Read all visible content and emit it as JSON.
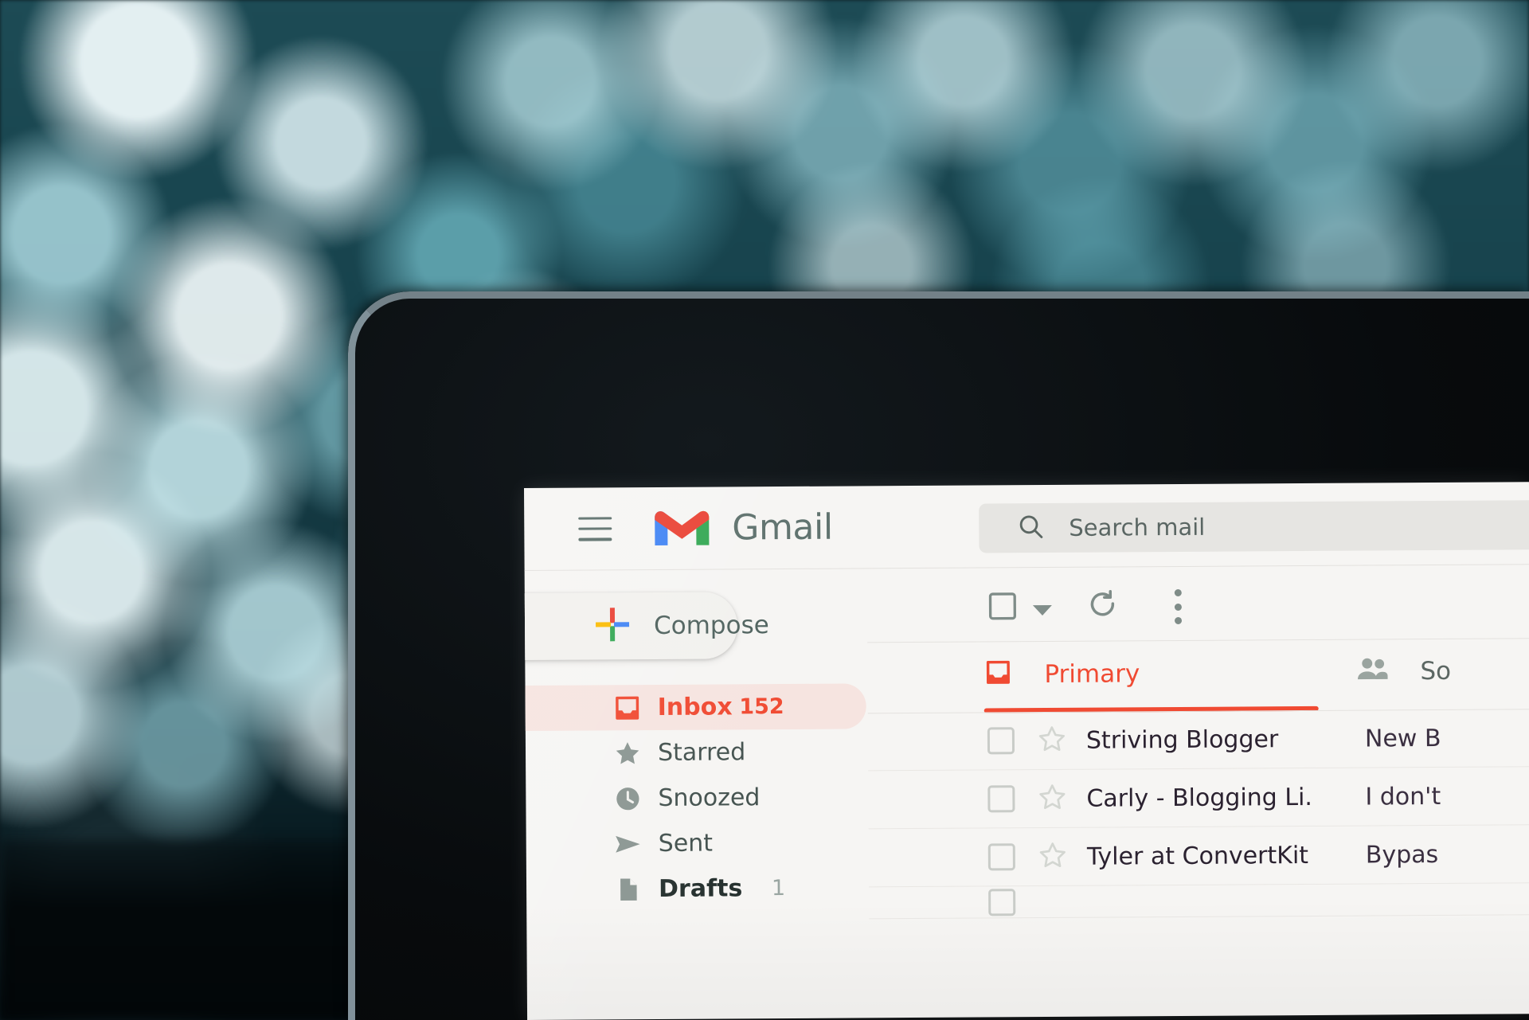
{
  "app": {
    "name": "Gmail",
    "brand_red": "#f04a32",
    "menu_icon": "hamburger-menu-icon",
    "logo_icon": "gmail-m-logo"
  },
  "search": {
    "icon": "search-icon",
    "placeholder": "Search mail",
    "value": ""
  },
  "sidebar": {
    "compose": {
      "label": "Compose",
      "icon": "plus-icon"
    },
    "items": [
      {
        "label": "Inbox",
        "count": "152",
        "icon": "inbox-icon",
        "active": true
      },
      {
        "label": "Starred",
        "count": "",
        "icon": "star-icon",
        "active": false
      },
      {
        "label": "Snoozed",
        "count": "",
        "icon": "clock-icon",
        "active": false
      },
      {
        "label": "Sent",
        "count": "",
        "icon": "send-icon",
        "active": false
      },
      {
        "label": "Drafts",
        "count": "1",
        "icon": "draft-icon",
        "active": false
      }
    ]
  },
  "toolbar": {
    "select_all": "select-all-checkbox",
    "select_caret": "chevron-down-icon",
    "refresh": "refresh-icon",
    "more": "more-options-icon"
  },
  "tabs": [
    {
      "label": "Primary",
      "icon": "inbox-icon",
      "active": true
    },
    {
      "label": "So",
      "icon": "people-icon",
      "active": false
    }
  ],
  "mail_list": {
    "rows": [
      {
        "sender": "Striving Blogger",
        "subject": "New B"
      },
      {
        "sender": "Carly - Blogging Li.",
        "subject": "I don't"
      },
      {
        "sender": "Tyler at ConvertKit",
        "subject": "Bypas"
      }
    ]
  }
}
